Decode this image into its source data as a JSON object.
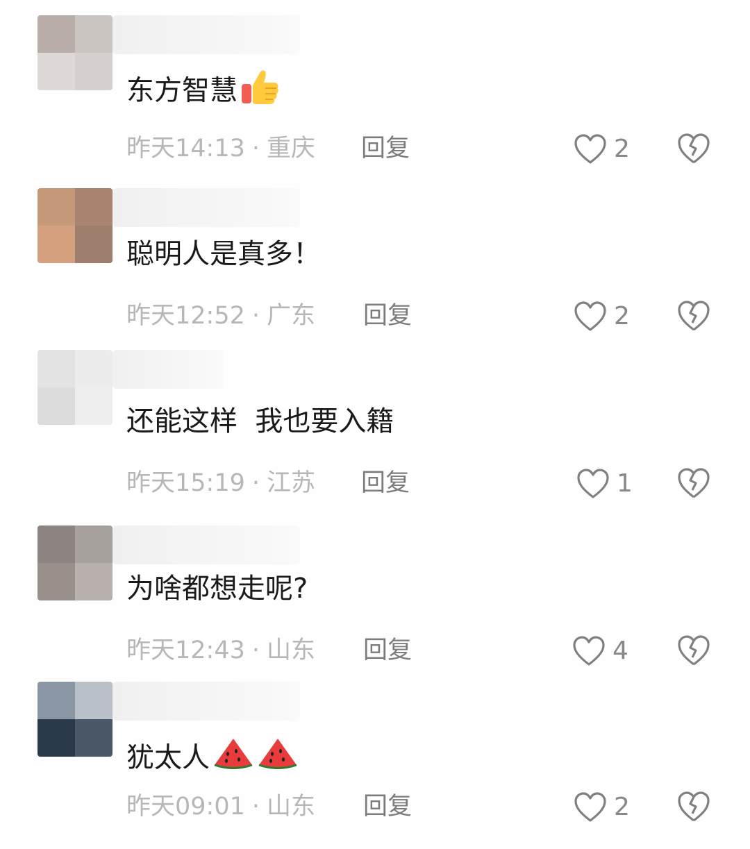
{
  "comments": [
    {
      "text": "东方智慧",
      "emoji": "thumbs-up",
      "time": "昨天14:13",
      "location": "重庆",
      "reply_label": "回复",
      "likes": "2",
      "avatar_colors": [
        "#b8ada8",
        "#cbc5c2",
        "#ded9d6",
        "#d5d0cd"
      ]
    },
    {
      "text": "聪明人是真多！",
      "time": "昨天12:52",
      "location": "广东",
      "reply_label": "回复",
      "likes": "2",
      "avatar_colors": [
        "#c69a78",
        "#a98470",
        "#d4a07e",
        "#9e7f6e"
      ]
    },
    {
      "text": "还能这样  我也要入籍",
      "time": "昨天15:19",
      "location": "江苏",
      "reply_label": "回复",
      "likes": "1",
      "avatar_colors": [
        "#e3e3e3",
        "#ececec",
        "#dcdcdc",
        "#eeeeee"
      ]
    },
    {
      "text": "为啥都想走呢?",
      "time": "昨天12:43",
      "location": "山东",
      "reply_label": "回复",
      "likes": "4",
      "avatar_colors": [
        "#8c8480",
        "#a7a19e",
        "#9a908b",
        "#b7b0ad"
      ]
    },
    {
      "text": "犹太人",
      "emoji": "watermelon",
      "time": "昨天09:01",
      "location": "山东",
      "reply_label": "回复",
      "likes": "2",
      "avatar_colors": [
        "#8a96a3",
        "#b9c0c8",
        "#2b3a4a",
        "#4a5868"
      ]
    }
  ],
  "icons": {
    "like": "heart-outline-icon",
    "dislike": "broken-heart-icon"
  },
  "colors": {
    "text": "#1a1a1a",
    "meta": "#b7b7b7",
    "reply": "#7c7c7c",
    "icon": "#808080"
  }
}
